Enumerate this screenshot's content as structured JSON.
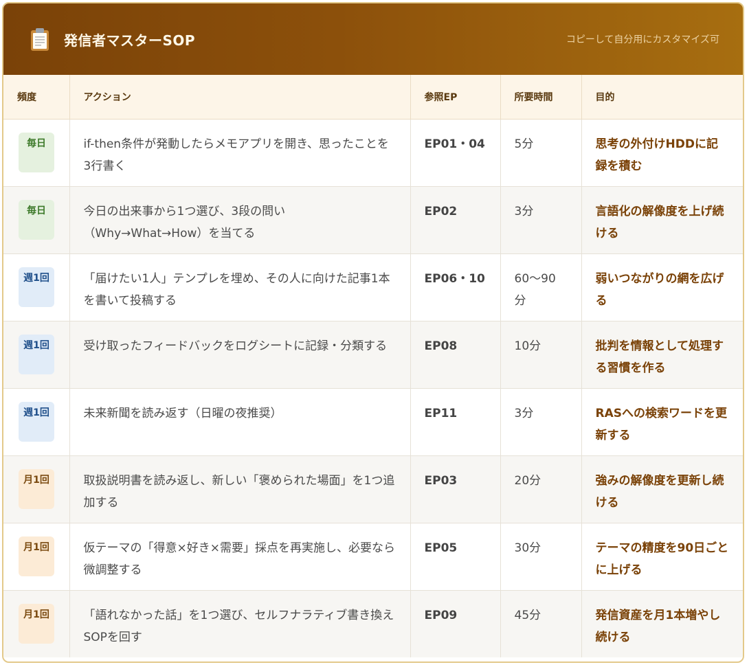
{
  "header": {
    "title": "発信者マスターSOP",
    "note": "コピーして自分用にカスタマイズ可",
    "icon": "clipboard-icon"
  },
  "table": {
    "columns": [
      "頻度",
      "アクション",
      "参照EP",
      "所要時間",
      "目的"
    ],
    "rows": [
      {
        "freq": "毎日",
        "freq_type": "daily",
        "action": "if-then条件が発動したらメモアプリを開き、思ったことを3行書く",
        "ep": "EP01・04",
        "time": "5分",
        "purpose": "思考の外付けHDDに記録を積む"
      },
      {
        "freq": "毎日",
        "freq_type": "daily",
        "action": "今日の出来事から1つ選び、3段の問い（Why→What→How）を当てる",
        "ep": "EP02",
        "time": "3分",
        "purpose": "言語化の解像度を上げ続ける"
      },
      {
        "freq": "週1回",
        "freq_type": "weekly",
        "action": "「届けたい1人」テンプレを埋め、その人に向けた記事1本を書いて投稿する",
        "ep": "EP06・10",
        "time": "60〜90分",
        "purpose": "弱いつながりの網を広げる"
      },
      {
        "freq": "週1回",
        "freq_type": "weekly",
        "action": "受け取ったフィードバックをログシートに記録・分類する",
        "ep": "EP08",
        "time": "10分",
        "purpose": "批判を情報として処理する習慣を作る"
      },
      {
        "freq": "週1回",
        "freq_type": "weekly",
        "action": "未来新聞を読み返す（日曜の夜推奨）",
        "ep": "EP11",
        "time": "3分",
        "purpose": "RASへの検索ワードを更新する"
      },
      {
        "freq": "月1回",
        "freq_type": "monthly",
        "action": "取扱説明書を読み返し、新しい「褒められた場面」を1つ追加する",
        "ep": "EP03",
        "time": "20分",
        "purpose": "強みの解像度を更新し続ける"
      },
      {
        "freq": "月1回",
        "freq_type": "monthly",
        "action": "仮テーマの「得意×好き×需要」採点を再実施し、必要なら微調整する",
        "ep": "EP05",
        "time": "30分",
        "purpose": "テーマの精度を90日ごとに上げる"
      },
      {
        "freq": "月1回",
        "freq_type": "monthly",
        "action": "「語れなかった話」を1つ選び、セルフナラティブ書き換えSOPを回す",
        "ep": "EP09",
        "time": "45分",
        "purpose": "発信資産を月1本増やし続ける"
      }
    ]
  }
}
